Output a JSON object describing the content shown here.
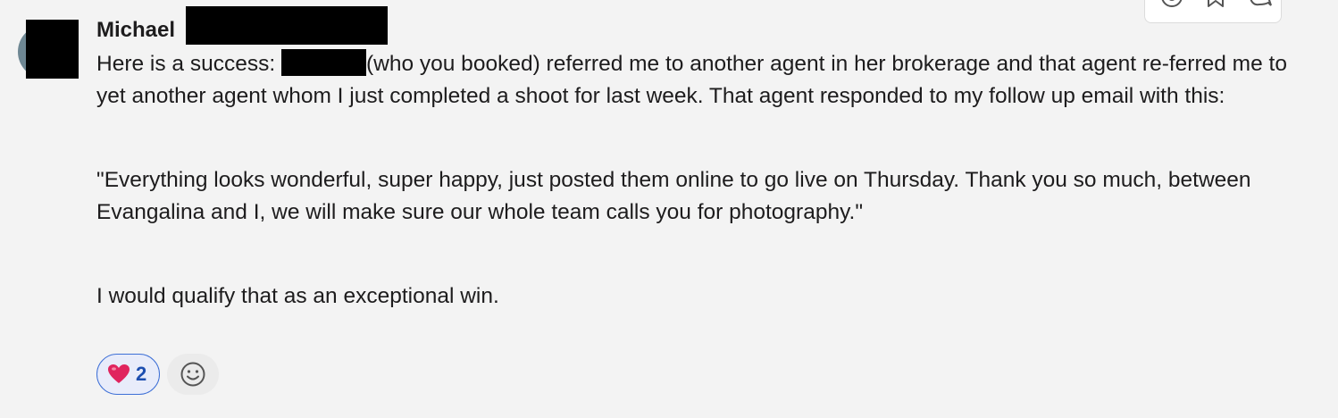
{
  "message": {
    "author": "Michael",
    "paragraphs": {
      "p1_before": "Here is a success: ",
      "p1_after": "(who you booked) referred me to another agent in her brokerage and that agent re-ferred me to yet another agent whom I just completed a shoot for last week. That agent responded to my follow up email with this:",
      "p2": "\"Everything looks wonderful, super happy, just posted them online to go live on Thursday. Thank you so much, between Evangalina and I, we will make sure our whole team calls you for photography.\"",
      "p3": "I would qualify that as an exceptional win."
    }
  },
  "reactions": [
    {
      "emoji": "heart-emoji",
      "count": "2",
      "color": "#e0245e"
    }
  ],
  "toolbar": {
    "icons": [
      "reply-icon",
      "bookmark-icon",
      "comment-icon"
    ]
  },
  "colors": {
    "background": "#f3f3f3",
    "reaction_border": "#3d6fd6",
    "reaction_bg": "#e8ecfa",
    "reaction_count": "#1d4fb0"
  }
}
